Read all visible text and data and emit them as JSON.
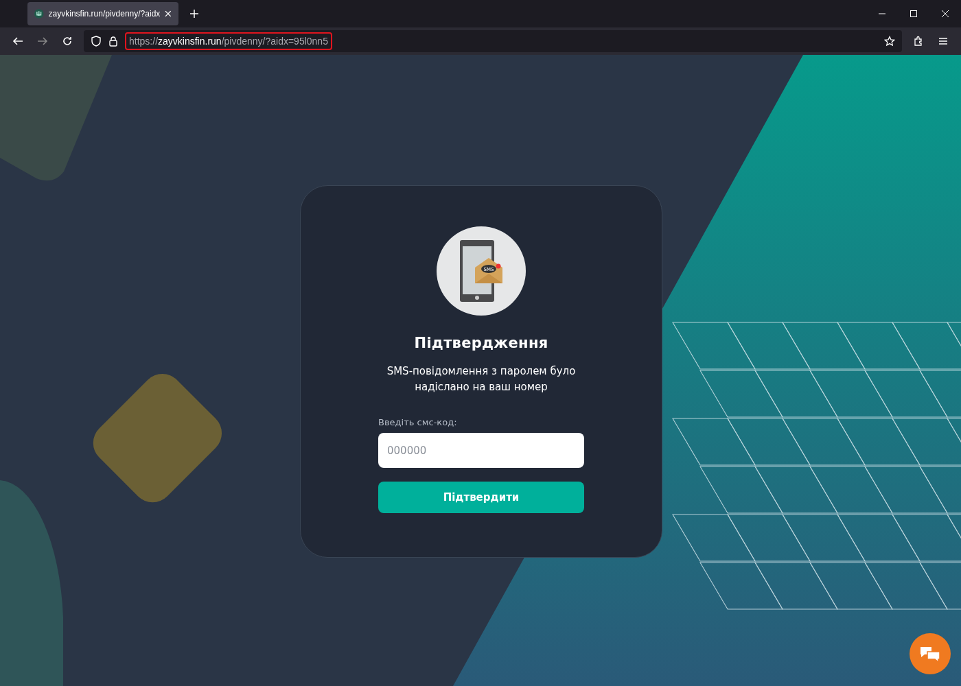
{
  "browser": {
    "tab": {
      "title": "zayvkinsfin.run/pivdenny/?aidx",
      "selected": true
    },
    "address": {
      "scheme": "https://",
      "host": "zayvkinsfin.run",
      "path": "/pivdenny/?aidx=95l0nn5",
      "highlighted": true
    }
  },
  "card": {
    "sms_badge": "SMS",
    "title": "Підтвердження",
    "message": "SMS-повідомлення з паролем було надіслано на ваш номер",
    "field_label": "Введіть смс-код:",
    "field": {
      "placeholder": "000000"
    },
    "button": "Підтвердити"
  }
}
